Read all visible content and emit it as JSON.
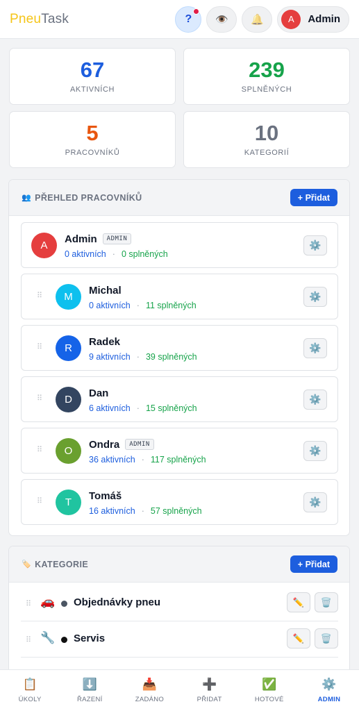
{
  "header": {
    "logo_part1": "Pneu",
    "logo_part2": "Task",
    "help_label": "?",
    "user_initial": "A",
    "user_name": "Admin"
  },
  "stats": [
    {
      "value": "67",
      "label": "AKTIVNÍCH",
      "color": "#1d5ede"
    },
    {
      "value": "239",
      "label": "SPLNĚNÝCH",
      "color": "#16a34a"
    },
    {
      "value": "5",
      "label": "PRACOVNÍKŮ",
      "color": "#e8560f"
    },
    {
      "value": "10",
      "label": "KATEGORIÍ",
      "color": "#6b7280"
    }
  ],
  "workers_panel": {
    "title": "PŘEHLED PRACOVNÍKŮ",
    "add_label": "+ Přidat",
    "separator": "·",
    "workers": [
      {
        "initial": "A",
        "name": "Admin",
        "badge": "ADMIN",
        "active": "0 aktivních",
        "done": "0 splněných",
        "color": "#e53e3e"
      },
      {
        "initial": "M",
        "name": "Michal",
        "badge": "",
        "active": "0 aktivních",
        "done": "11 splněných",
        "color": "#0ec0ee"
      },
      {
        "initial": "R",
        "name": "Radek",
        "badge": "",
        "active": "9 aktivních",
        "done": "39 splněných",
        "color": "#1563e8"
      },
      {
        "initial": "D",
        "name": "Dan",
        "badge": "",
        "active": "6 aktivních",
        "done": "15 splněných",
        "color": "#334560"
      },
      {
        "initial": "O",
        "name": "Ondra",
        "badge": "ADMIN",
        "active": "36 aktivních",
        "done": "117 splněných",
        "color": "#6aa02f"
      },
      {
        "initial": "T",
        "name": "Tomáš",
        "badge": "",
        "active": "16 aktivních",
        "done": "57 splněných",
        "color": "#20c4a0"
      }
    ]
  },
  "categories_panel": {
    "title": "KATEGORIE",
    "add_label": "+ Přidat",
    "categories": [
      {
        "icon": "🚗",
        "name": "Objednávky pneu",
        "dot_color": "#4b5563"
      },
      {
        "icon": "🔧",
        "name": "Servis",
        "dot_color": "#111111"
      }
    ]
  },
  "bottom_nav": [
    {
      "icon": "clipboard-icon",
      "glyph": "📋",
      "label": "ÚKOLY",
      "active": false
    },
    {
      "icon": "sort-icon",
      "glyph": "⬇️",
      "label": "ŘAZENÍ",
      "active": false
    },
    {
      "icon": "inbox-icon",
      "glyph": "📥",
      "label": "ZADÁNO",
      "active": false
    },
    {
      "icon": "plus-icon",
      "glyph": "➕",
      "label": "PŘIDAT",
      "active": false
    },
    {
      "icon": "check-icon",
      "glyph": "✅",
      "label": "HOTOVÉ",
      "active": false
    },
    {
      "icon": "gear-icon",
      "glyph": "⚙️",
      "label": "ADMIN",
      "active": true
    }
  ]
}
